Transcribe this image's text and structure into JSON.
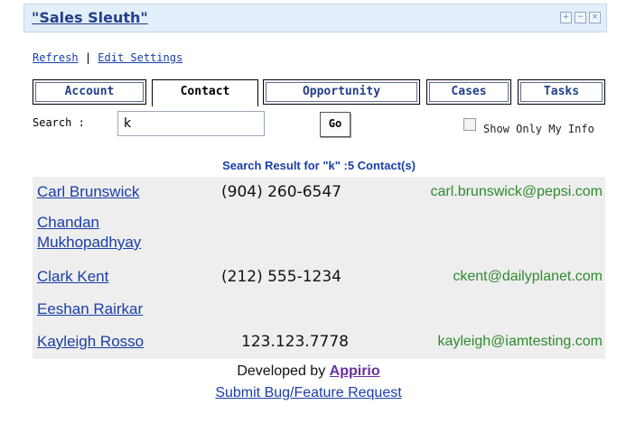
{
  "gadget": {
    "title": "\"Sales Sleuth\"",
    "icons": [
      "+",
      "−",
      "×"
    ]
  },
  "links": {
    "refresh": "Refresh",
    "separator": "|",
    "edit_settings": "Edit Settings"
  },
  "tabs": [
    {
      "label": "Account",
      "active": false
    },
    {
      "label": "Contact",
      "active": true
    },
    {
      "label": "Opportunity",
      "active": false
    },
    {
      "label": "Cases",
      "active": false
    },
    {
      "label": "Tasks",
      "active": false
    }
  ],
  "search": {
    "label": "Search :",
    "value": "k",
    "go_label": "Go",
    "show_only_mine_label": "Show Only My Info",
    "show_only_mine_checked": false
  },
  "results": {
    "heading": "Search Result for \"k\" :5 Contact(s)",
    "rows": [
      {
        "name": "Carl Brunswick",
        "name2": "",
        "phone": "(904) 260-6547",
        "email": "carl.brunswick@pepsi.com"
      },
      {
        "name": "Chandan",
        "name2": "Mukhopadhyay",
        "phone": "",
        "email": ""
      },
      {
        "name": "Clark Kent",
        "name2": "",
        "phone": "(212) 555-1234",
        "email": "ckent@dailyplanet.com"
      },
      {
        "name": "Eeshan Rairkar",
        "name2": "",
        "phone": "",
        "email": ""
      },
      {
        "name": "Kayleigh Rosso",
        "name2": "",
        "phone": "123.123.7778",
        "email": "kayleigh@iamtesting.com"
      }
    ]
  },
  "footer": {
    "developed_by": "Developed by",
    "company": "Appirio",
    "bug_link": "Submit Bug/Feature Request"
  }
}
